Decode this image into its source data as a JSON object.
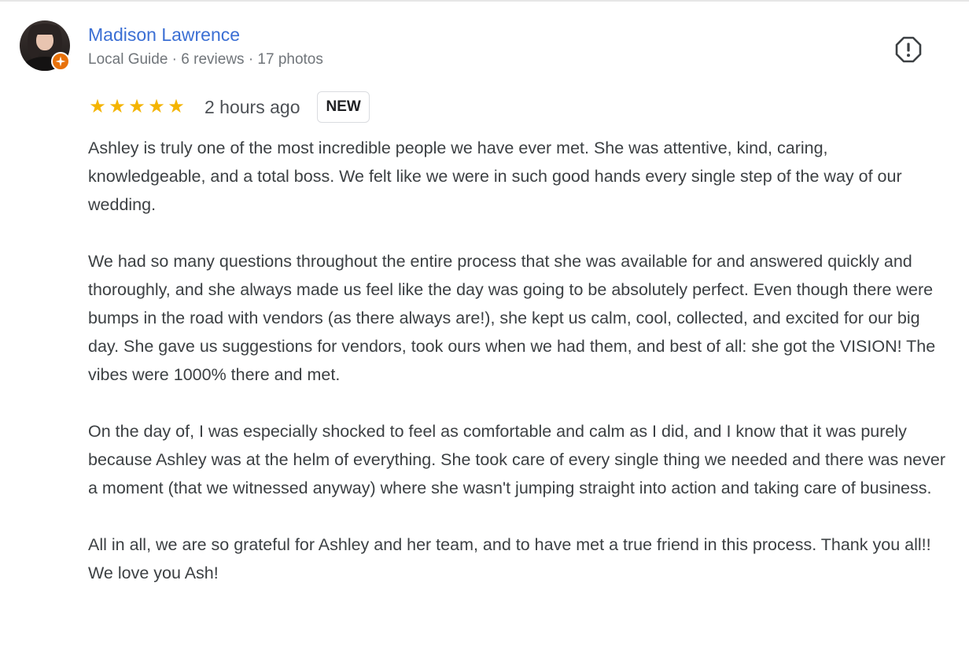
{
  "reviewer": {
    "name": "Madison Lawrence",
    "meta": "Local Guide · 6 reviews · 17 photos",
    "avatar_icon": "user-avatar-photo",
    "badge_icon": "local-guide-star-icon",
    "badge_color": "#e8710a"
  },
  "rating": {
    "stars": 5,
    "max_stars": 5,
    "star_color": "#f4b400",
    "time_ago": "2 hours ago",
    "badge": "NEW"
  },
  "actions": {
    "report_icon": "report-exclamation-icon"
  },
  "colors": {
    "name_link": "#3b6fd4",
    "meta_text": "#70757a",
    "body_text": "#3c4043"
  },
  "review": {
    "paragraphs": [
      "Ashley is truly one of the most incredible people we have ever met. She was attentive, kind, caring, knowledgeable, and a total boss. We felt like we were in such good hands every single step of the way of our wedding.",
      "We had so many questions throughout the entire process that she was available for and answered quickly and thoroughly, and she always made us feel like the day was going to be absolutely perfect. Even though there were bumps in the road with vendors (as there always are!), she kept us calm, cool, collected, and excited for our big day. She gave us suggestions for vendors, took ours when we had them, and best of all: she got the VISION! The vibes were 1000% there and met.",
      "On the day of, I was especially shocked to feel as comfortable and calm as I did, and I know that it was purely because Ashley was at the helm of everything. She took care of every single thing we needed and there was never a moment (that we witnessed anyway) where she wasn't jumping straight into action and taking care of business.",
      "All in all, we are so grateful for Ashley and her team, and to have met a true friend in this process. Thank you all!! We love you Ash!"
    ]
  }
}
